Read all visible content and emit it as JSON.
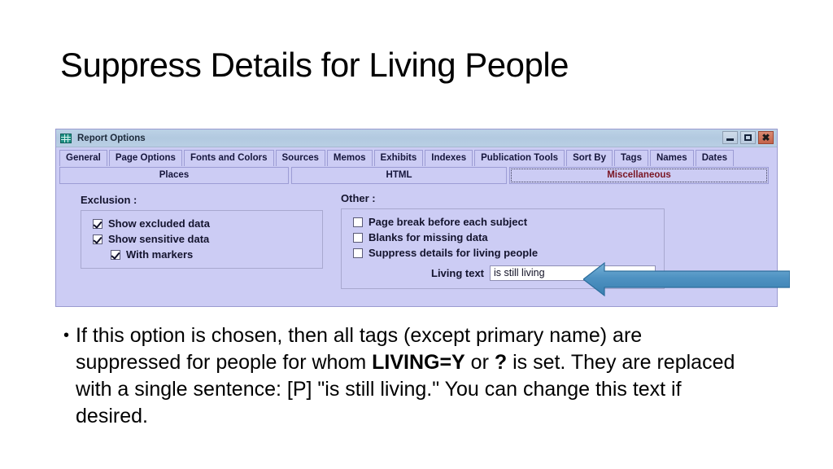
{
  "slide": {
    "title": "Suppress Details for Living People"
  },
  "dialog": {
    "window_icon": "grid-table-icon",
    "title": "Report Options",
    "window_buttons": {
      "minimize": "minimize-icon",
      "maximize": "maximize-icon",
      "close": "✖"
    },
    "tabs_row1": [
      {
        "label": "General"
      },
      {
        "label": "Page Options"
      },
      {
        "label": "Fonts and Colors"
      },
      {
        "label": "Sources"
      },
      {
        "label": "Memos"
      },
      {
        "label": "Exhibits"
      },
      {
        "label": "Indexes"
      },
      {
        "label": "Publication Tools"
      },
      {
        "label": "Sort By"
      },
      {
        "label": "Tags"
      },
      {
        "label": "Names"
      },
      {
        "label": "Dates"
      }
    ],
    "tabs_row2": [
      {
        "label": "Places",
        "selected": false
      },
      {
        "label": "HTML",
        "selected": false
      },
      {
        "label": "Miscellaneous",
        "selected": true
      }
    ],
    "exclusion": {
      "group_label": "Exclusion :",
      "options": [
        {
          "label": "Show excluded data",
          "checked": true,
          "indent": false
        },
        {
          "label": "Show sensitive data",
          "checked": true,
          "indent": false
        },
        {
          "label": "With markers",
          "checked": true,
          "indent": true
        }
      ]
    },
    "other": {
      "group_label": "Other :",
      "options": [
        {
          "label": "Page break before each subject",
          "checked": false
        },
        {
          "label": "Blanks for missing data",
          "checked": false
        },
        {
          "label": "Suppress details for living people",
          "checked": false
        }
      ],
      "living_text_label": "Living text",
      "living_text_value": "is still living",
      "living_text_placeholder": ""
    }
  },
  "annotation": {
    "arrow": "left-pointing-arrow",
    "arrow_color": "#4a90c4",
    "arrow_edge_color": "#2f6f9e"
  },
  "body_bullet": {
    "marker": "•",
    "part1": "If this option is chosen, then all tags (except primary name) are suppressed for people for whom ",
    "bold1": "LIVING=Y",
    "part2": " or ",
    "bold2": "?",
    "part3": " is set. They are replaced with a single sentence: [P] \"is still living.\" You can change this text if desired."
  },
  "colors": {
    "titlebar": "#b7cde2",
    "dialog_bg": "#ccccf4",
    "tab_border": "#9c9cd4",
    "selected_tab_text": "#7a1523",
    "close_button": "#c4634a"
  }
}
